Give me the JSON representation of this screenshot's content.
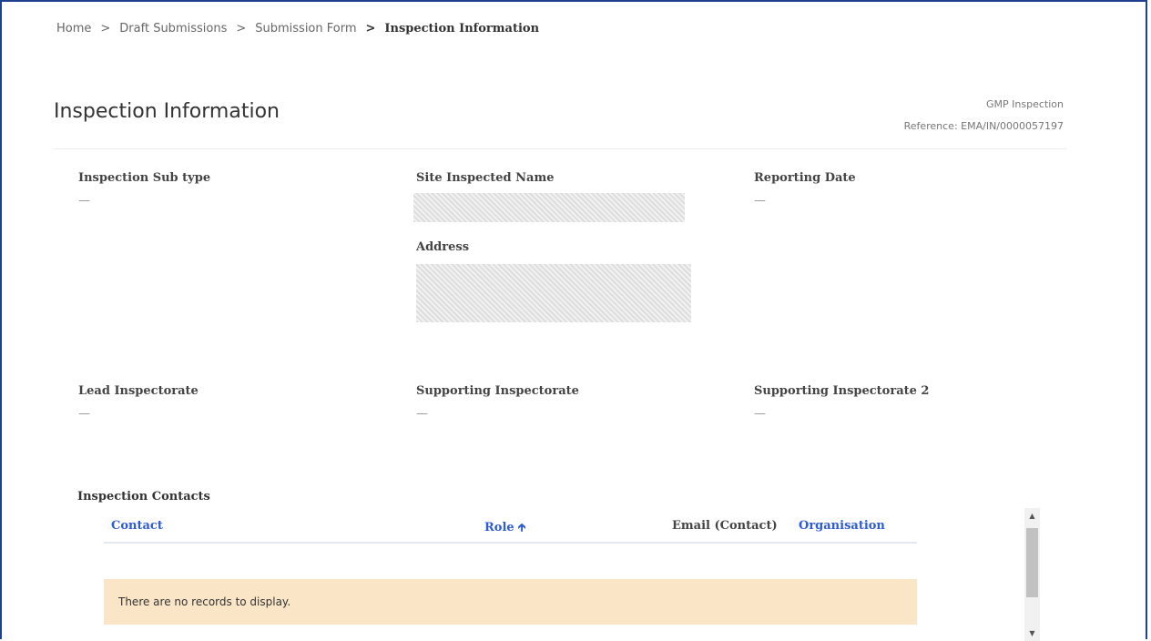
{
  "breadcrumb": {
    "items": [
      "Home",
      "Draft Submissions",
      "Submission Form"
    ],
    "current": "Inspection Information",
    "separator": ">"
  },
  "page": {
    "title": "Inspection Information",
    "type": "GMP Inspection",
    "reference": "Reference: EMA/IN/0000057197"
  },
  "fields": {
    "inspection_sub_type": {
      "label": "Inspection Sub type",
      "value": "—"
    },
    "site_inspected_name": {
      "label": "Site Inspected Name"
    },
    "address": {
      "label": "Address"
    },
    "reporting_date": {
      "label": "Reporting Date",
      "value": "—"
    },
    "lead_inspectorate": {
      "label": "Lead Inspectorate",
      "value": "—"
    },
    "supporting_inspectorate": {
      "label": "Supporting Inspectorate",
      "value": "—"
    },
    "supporting_inspectorate_2": {
      "label": "Supporting Inspectorate 2",
      "value": "—"
    }
  },
  "contacts": {
    "title": "Inspection Contacts",
    "columns": {
      "contact": "Contact",
      "role": "Role",
      "email": "Email (Contact)",
      "organisation": "Organisation"
    },
    "sort_icon": "arrow-up-icon",
    "empty_message": "There are no records to display."
  },
  "colors": {
    "link": "#2e5bd6",
    "empty_bg": "#fae5c7",
    "frame": "#1f3f8f"
  }
}
